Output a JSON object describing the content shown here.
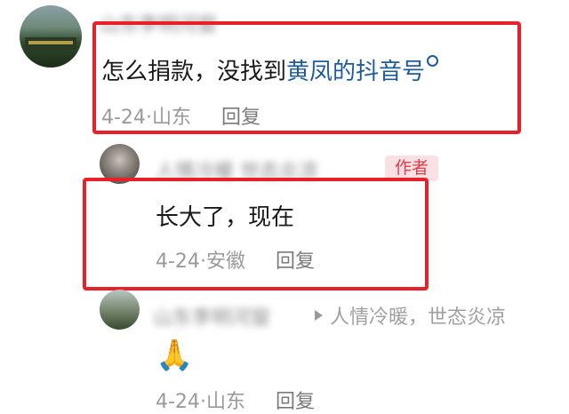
{
  "comments": [
    {
      "username": "山东李明河窗",
      "text_prefix": "怎么捐款，没找到",
      "text_link": "黄凤的抖音号",
      "date": "4-24",
      "location": "山东",
      "reply_label": "回复"
    },
    {
      "username": "人情冷暖 世态炎凉",
      "badge": "作者",
      "text": "长大了，现在",
      "date": "4-24",
      "location": "安徽",
      "reply_label": "回复"
    },
    {
      "username": "山东李明河窗",
      "reply_to": "人情冷暖，世态炎凉",
      "text": "🙏",
      "date": "4-24",
      "location": "山东",
      "reply_label": "回复"
    }
  ],
  "colors": {
    "highlight_box": "#e8202a",
    "link": "#1e5b9a",
    "badge_bg": "#fbe1e4",
    "badge_text": "#e33a4a"
  }
}
